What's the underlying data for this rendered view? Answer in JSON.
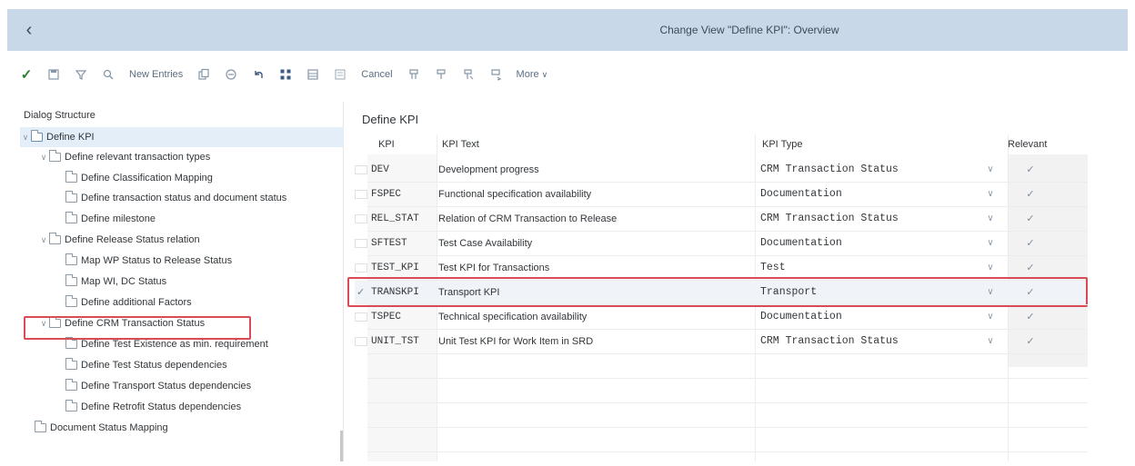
{
  "shell": {
    "title": "Change View \"Define KPI\": Overview"
  },
  "toolbar": {
    "new_entries": "New Entries",
    "cancel": "Cancel",
    "more": "More"
  },
  "dialog_structure": {
    "title": "Dialog Structure",
    "nodes": [
      {
        "label": "Define KPI",
        "level": 0,
        "expanded": true,
        "selected": true
      },
      {
        "label": "Define relevant transaction types",
        "level": 1,
        "expanded": true
      },
      {
        "label": "Define Classification Mapping",
        "level": 2
      },
      {
        "label": "Define transaction status and document status",
        "level": 2
      },
      {
        "label": "Define milestone",
        "level": 2
      },
      {
        "label": "Define Release Status relation",
        "level": 1,
        "expanded": true
      },
      {
        "label": "Map WP Status to Release Status",
        "level": 2
      },
      {
        "label": "Map WI, DC Status",
        "level": 2
      },
      {
        "label": "Define additional Factors",
        "level": 2
      },
      {
        "label": "Define CRM Transaction Status",
        "level": 1,
        "expanded": true,
        "highlighted": true
      },
      {
        "label": "Define Test Existence as min. requirement",
        "level": 2
      },
      {
        "label": "Define Test Status dependencies",
        "level": 2
      },
      {
        "label": "Define Transport Status dependencies",
        "level": 2
      },
      {
        "label": "Define Retrofit Status dependencies",
        "level": 2
      },
      {
        "label": "Document Status Mapping",
        "level": 0
      }
    ]
  },
  "table": {
    "title": "Define KPI",
    "headers": {
      "kpi": "KPI",
      "text": "KPI Text",
      "type": "KPI Type",
      "relevant": "Relevant"
    },
    "rows": [
      {
        "kpi": "DEV",
        "text": "Development progress",
        "type": "CRM Transaction Status",
        "relevant": true
      },
      {
        "kpi": "FSPEC",
        "text": "Functional specification availability",
        "type": "Documentation",
        "relevant": true
      },
      {
        "kpi": "REL_STAT",
        "text": "Relation of CRM Transaction to Release",
        "type": "CRM Transaction Status",
        "relevant": true
      },
      {
        "kpi": "SFTEST",
        "text": "Test Case Availability",
        "type": "Documentation",
        "relevant": true
      },
      {
        "kpi": "TEST_KPI",
        "text": "Test KPI for Transactions",
        "type": "Test",
        "relevant": true
      },
      {
        "kpi": "TRANSKPI",
        "text": "Transport KPI",
        "type": "Transport",
        "relevant": true,
        "selected": true,
        "highlighted": true
      },
      {
        "kpi": "TSPEC",
        "text": "Technical specification availability",
        "type": "Documentation",
        "relevant": true
      },
      {
        "kpi": "UNIT_TST",
        "text": "Unit Test KPI for Work Item in SRD",
        "type": "CRM Transaction Status",
        "relevant": true
      }
    ]
  },
  "colors": {
    "shell_bg": "#c9d8e8",
    "highlight": "#d94c55",
    "selection_bg": "#e4eef8"
  }
}
